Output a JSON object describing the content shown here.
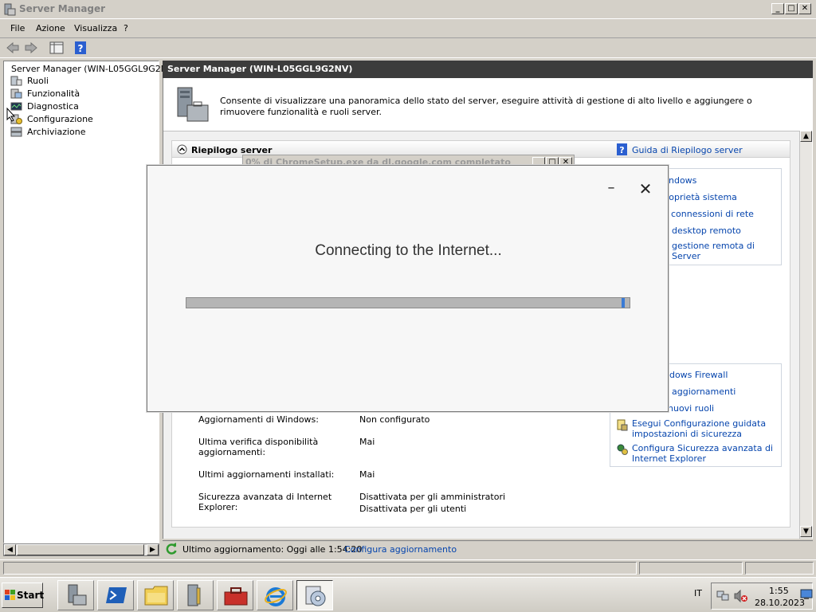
{
  "window": {
    "title": "Server Manager",
    "menu": [
      "File",
      "Azione",
      "Visualizza",
      "?"
    ],
    "controls": {
      "minimize": "_",
      "maximize": "□",
      "close": "✕"
    }
  },
  "tree": {
    "root": "Server Manager (WIN-L05GGL9G2NV)",
    "items": [
      "Ruoli",
      "Funzionalità",
      "Diagnostica",
      "Configurazione",
      "Archiviazione"
    ]
  },
  "main": {
    "header": "Server Manager (WIN-L05GGL9G2NV)",
    "intro": "Consente di visualizzare una panoramica dello stato del server, eseguire attività di gestione di alto livello e aggiungere o rimuovere funzionalità e ruoli server.",
    "section_title": "Riepilogo server",
    "help_link": "Guida di Riepilogo server",
    "tasks_top": [
      "ndows",
      "proprietà sistema",
      "connessioni di rete",
      "desktop remoto",
      "gestione remota di Server"
    ],
    "tasks_bottom": [
      "ndows Firewall",
      "aggiornamenti",
      "nuovi ruoli",
      "Esegui Configurazione guidata impostazioni di sicurezza",
      "Configura Sicurezza avanzata di Internet Explorer"
    ],
    "rows": [
      {
        "label": "Aggiornamenti di Windows:",
        "value": "Non configurato"
      },
      {
        "label": "Ultima verifica disponibilità aggiornamenti:",
        "value": "Mai"
      },
      {
        "label": "Ultimi aggiornamenti installati:",
        "value": "Mai"
      },
      {
        "label": "Sicurezza avanzata di Internet Explorer:",
        "value": "Disattivata per gli amministratori",
        "value2": "Disattivata per gli utenti"
      }
    ],
    "last_update": "Ultimo aggiornamento: Oggi alle 1:54:20",
    "configure_update": "Configura aggiornamento"
  },
  "bg_dialog": {
    "title": "0% di ChromeSetup.exe da dl.google.com completato"
  },
  "chrome_dialog": {
    "message": "Connecting to the Internet...",
    "minimize": "–",
    "close": "✕",
    "progress": 0.99
  },
  "taskbar": {
    "start": "Start",
    "language": "IT",
    "time": "1:55",
    "date": "28.10.2023"
  },
  "colors": {
    "header_bg": "#3c3c3c",
    "link": "#0645ad",
    "progress": "#3a7bd5"
  }
}
